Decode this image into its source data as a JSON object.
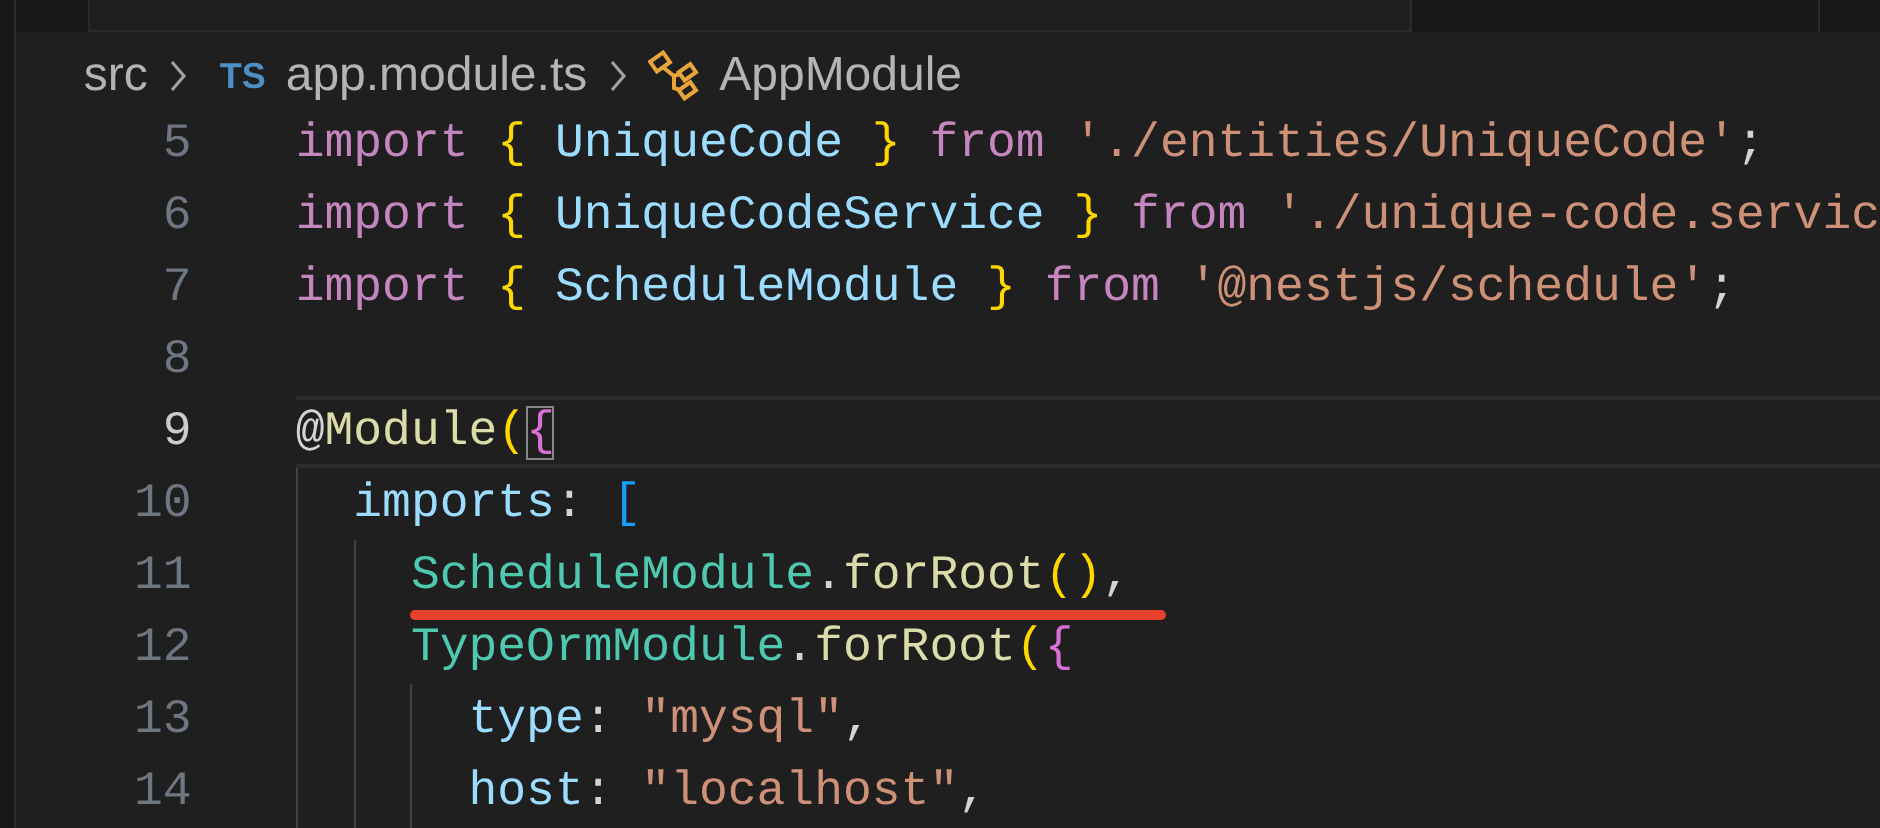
{
  "breadcrumb": [
    {
      "kind": "folder",
      "label": "src"
    },
    {
      "kind": "file",
      "badge": "TS",
      "label": "app.module.ts"
    },
    {
      "kind": "symbol",
      "label": "AppModule"
    }
  ],
  "lines": [
    {
      "number": "5",
      "current": false,
      "underlined": false,
      "tokens": [
        {
          "kind": "keyword",
          "text": "import "
        },
        {
          "kind": "brace1",
          "text": "{ "
        },
        {
          "kind": "var",
          "text": "UniqueCode "
        },
        {
          "kind": "brace1",
          "text": "} "
        },
        {
          "kind": "keyword",
          "text": "from "
        },
        {
          "kind": "string",
          "text": "'./entities/UniqueCode'"
        },
        {
          "kind": "plain",
          "text": ";"
        }
      ]
    },
    {
      "number": "6",
      "current": false,
      "underlined": false,
      "tokens": [
        {
          "kind": "keyword",
          "text": "import "
        },
        {
          "kind": "brace1",
          "text": "{ "
        },
        {
          "kind": "var",
          "text": "UniqueCodeService "
        },
        {
          "kind": "brace1",
          "text": "} "
        },
        {
          "kind": "keyword",
          "text": "from "
        },
        {
          "kind": "string",
          "text": "'./unique-code.servic"
        }
      ]
    },
    {
      "number": "7",
      "current": false,
      "underlined": false,
      "tokens": [
        {
          "kind": "keyword",
          "text": "import "
        },
        {
          "kind": "brace1",
          "text": "{ "
        },
        {
          "kind": "var",
          "text": "ScheduleModule "
        },
        {
          "kind": "brace1",
          "text": "} "
        },
        {
          "kind": "keyword",
          "text": "from "
        },
        {
          "kind": "string",
          "text": "'@nestjs/schedule'"
        },
        {
          "kind": "plain",
          "text": ";"
        }
      ]
    },
    {
      "number": "8",
      "current": false,
      "underlined": false
    },
    {
      "number": "9",
      "current": true,
      "underlined": false,
      "tokens": [
        {
          "kind": "plain",
          "text": "@"
        },
        {
          "kind": "func",
          "text": "Module"
        },
        {
          "kind": "brace1",
          "text": "("
        },
        {
          "kind": "matched",
          "text": "{"
        }
      ]
    },
    {
      "number": "10",
      "current": false,
      "underlined": false,
      "tokens": [
        {
          "kind": "var",
          "text": "  imports"
        },
        {
          "kind": "plain",
          "text": ": "
        },
        {
          "kind": "brace3",
          "text": "["
        }
      ]
    },
    {
      "number": "11",
      "current": false,
      "underlined": true,
      "tokens": [
        {
          "kind": "type",
          "text": "    ScheduleModule"
        },
        {
          "kind": "plain",
          "text": "."
        },
        {
          "kind": "func",
          "text": "forRoot"
        },
        {
          "kind": "brace1",
          "text": "()"
        },
        {
          "kind": "plain",
          "text": ","
        }
      ]
    },
    {
      "number": "12",
      "current": false,
      "underlined": false,
      "tokens": [
        {
          "kind": "type",
          "text": "    TypeOrmModule"
        },
        {
          "kind": "plain",
          "text": "."
        },
        {
          "kind": "func",
          "text": "forRoot"
        },
        {
          "kind": "brace1",
          "text": "("
        },
        {
          "kind": "brace2",
          "text": "{"
        }
      ]
    },
    {
      "number": "13",
      "current": false,
      "underlined": false,
      "tokens": [
        {
          "kind": "var",
          "text": "      type"
        },
        {
          "kind": "plain",
          "text": ": "
        },
        {
          "kind": "string",
          "text": "\"mysql\""
        },
        {
          "kind": "plain",
          "text": ","
        }
      ]
    },
    {
      "number": "14",
      "current": false,
      "underlined": false,
      "tokens": [
        {
          "kind": "var",
          "text": "      host"
        },
        {
          "kind": "plain",
          "text": ": "
        },
        {
          "kind": "string",
          "text": "\"localhost\""
        },
        {
          "kind": "plain",
          "text": ","
        }
      ]
    }
  ]
}
